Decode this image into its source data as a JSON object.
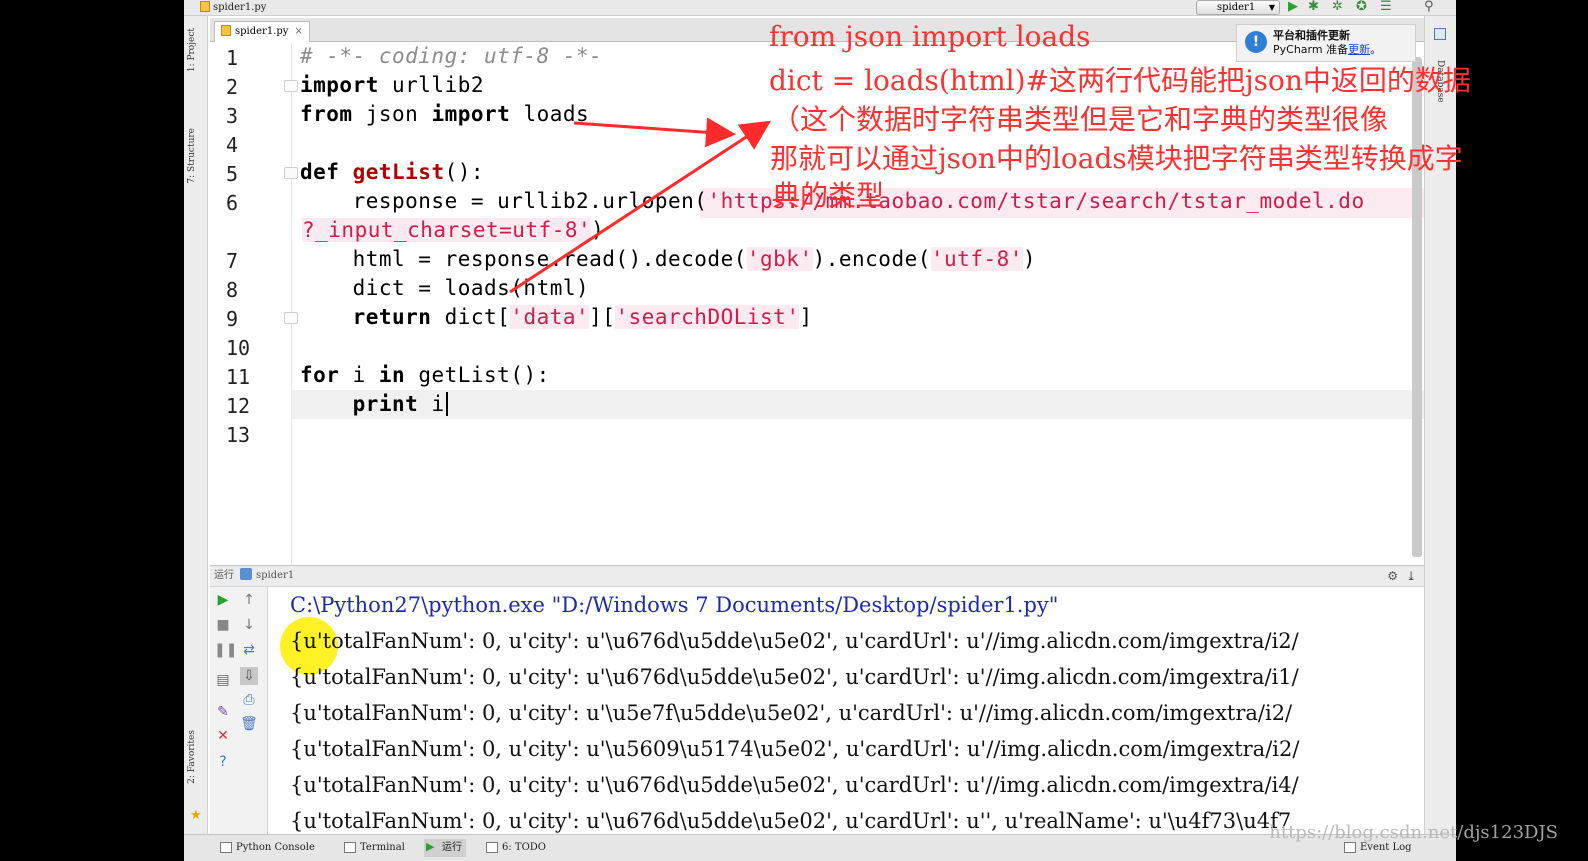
{
  "window": {
    "file_title": "spider1.py",
    "run_config": "spider1",
    "accent": "#ff3030"
  },
  "editor": {
    "tab_label": "spider1.py",
    "tab_close": "×",
    "line_numbers": [
      "1",
      "2",
      "3",
      "4",
      "5",
      "6",
      "",
      "7",
      "8",
      "9",
      "10",
      "11",
      "12",
      "13"
    ],
    "lines": {
      "l1": "# -*- coding: utf-8 -*-",
      "l2_kw": "import",
      "l2_rest": " urllib2",
      "l3_kw1": "from",
      "l3_mid": " json ",
      "l3_kw2": "import",
      "l3_rest": " loads",
      "l5_kw": "def",
      "l5_fn": "getList",
      "l5_rest": "():",
      "l6_pre": "    response = urllib2.urlopen(",
      "l6_str": "'https://mm.taobao.com/tstar/search/tstar_model.do",
      "l6b_str": "?_input_charset=utf-8'",
      "l6b_rest": ")",
      "l7_pre": "    html = response.read().decode(",
      "l7_s1": "'gbk'",
      "l7_mid": ").encode(",
      "l7_s2": "'utf-8'",
      "l7_end": ")",
      "l8": "    dict = loads(html)",
      "l9_kw": "return",
      "l9_pre": " dict[",
      "l9_s1": "'data'",
      "l9_mid": "][",
      "l9_s2": "'searchDOList'",
      "l9_end": "]",
      "l11_kw1": "for",
      "l11_mid": " i ",
      "l11_kw2": "in",
      "l11_rest": " getList():",
      "l12_kw": "print",
      "l12_rest": " i"
    }
  },
  "annotation": {
    "line1": "from   json import loads",
    "line2": "dict = loads(html)#这两行代码能把json中返回的数据",
    "line3": "（这个数据时字符串类型但是它和字典的类型很像",
    "line4": "那就可以通过json中的loads模块把字符串类型转换成字",
    "line5": "典的类型"
  },
  "notification": {
    "title": "平台和插件更新",
    "body_prefix": "PyCharm 准备",
    "link": "更新",
    "suffix": "。"
  },
  "side_tabs": {
    "project": "1: Project",
    "structure": "7: Structure",
    "favorites": "2: Favorites",
    "database": "Database"
  },
  "run_panel": {
    "header_label": "运行",
    "header_config": "spider1",
    "command": "C:\\Python27\\python.exe \"D:/Windows 7 Documents/Desktop/spider1.py\"",
    "output": [
      "{u'totalFanNum': 0, u'city': u'\\u676d\\u5dde\\u5e02', u'cardUrl': u'//img.alicdn.com/imgextra/i2/",
      "{u'totalFanNum': 0, u'city': u'\\u676d\\u5dde\\u5e02', u'cardUrl': u'//img.alicdn.com/imgextra/i1/",
      "{u'totalFanNum': 0, u'city': u'\\u5e7f\\u5dde\\u5e02', u'cardUrl': u'//img.alicdn.com/imgextra/i2/",
      "{u'totalFanNum': 0, u'city': u'\\u5609\\u5174\\u5e02', u'cardUrl': u'//img.alicdn.com/imgextra/i2/",
      "{u'totalFanNum': 0, u'city': u'\\u676d\\u5dde\\u5e02', u'cardUrl': u'//img.alicdn.com/imgextra/i4/",
      "{u'totalFanNum': 0, u'city': u'\\u676d\\u5dde\\u5e02', u'cardUrl': u'', u'realName': u'\\u4f73\\u4f7"
    ]
  },
  "statusbar": {
    "python_console": "Python Console",
    "terminal": "Terminal",
    "run": "运行",
    "todo": "6: TODO",
    "event_log": "Event Log"
  },
  "watermark": "https://blog.csdn.net/djs123DJS"
}
